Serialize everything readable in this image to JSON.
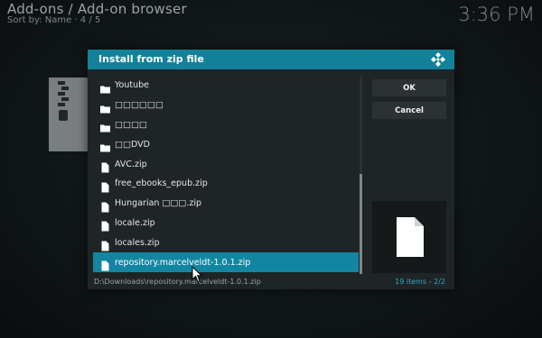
{
  "background": {
    "title": "Add-ons / Add-on browser",
    "sort_info": "Sort by: Name · 4 / 5",
    "clock": "3:36 PM"
  },
  "dialog": {
    "title": "Install from zip file",
    "ok_label": "OK",
    "cancel_label": "Cancel",
    "items": [
      {
        "label": "Youtube",
        "type": "folder"
      },
      {
        "label": "□□□□□□",
        "type": "folder"
      },
      {
        "label": "□□□□",
        "type": "folder"
      },
      {
        "label": "□□DVD",
        "type": "folder"
      },
      {
        "label": "AVC.zip",
        "type": "file"
      },
      {
        "label": "free_ebooks_epub.zip",
        "type": "file"
      },
      {
        "label": "Hungarian □□□.zip",
        "type": "file"
      },
      {
        "label": "locale.zip",
        "type": "file"
      },
      {
        "label": "locales.zip",
        "type": "file"
      },
      {
        "label": "repository.marcelveldt-1.0.1.zip",
        "type": "file",
        "selected": true
      }
    ],
    "footer_path": "D:\\Downloads\\repository.marcelveldt-1.0.1.zip",
    "item_count": "19 items",
    "page": "2/2"
  },
  "colors": {
    "accent": "#12829b",
    "dialog_bg": "#1f2426",
    "button_bg": "#2c3133"
  }
}
